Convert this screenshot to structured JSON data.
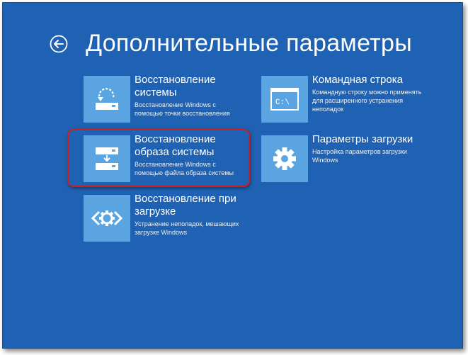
{
  "header": {
    "title": "Дополнительные параметры",
    "back_icon": "back-arrow-icon"
  },
  "tiles": {
    "system_restore": {
      "title": "Восстановление\nсистемы",
      "desc": "Восстановление Windows с\nпомощью точки восстановления",
      "icon": "system-restore-icon"
    },
    "image_recovery": {
      "title": "Восстановление\nобраза системы",
      "desc": "Восстановление Windows с\nпомощью файла образа системы",
      "icon": "image-restore-icon"
    },
    "startup_repair": {
      "title": "Восстановление при\nзагрузке",
      "desc": "Устранение неполадок, мешающих\nзагрузке Windows",
      "icon": "startup-repair-icon"
    },
    "command_prompt": {
      "title": "Командная строка",
      "desc": "Командную строку можно применять\nдля расширенного устранения\nнеполадок",
      "icon": "command-prompt-icon",
      "icon_text": "C:\\"
    },
    "startup_settings": {
      "title": "Параметры загрузки",
      "desc": "Настройка параметров загрузки\nWindows",
      "icon": "gear-icon"
    }
  },
  "colors": {
    "background": "#1f61b2",
    "tile": "#5aa4e2",
    "highlight": "#cc1f1f"
  }
}
